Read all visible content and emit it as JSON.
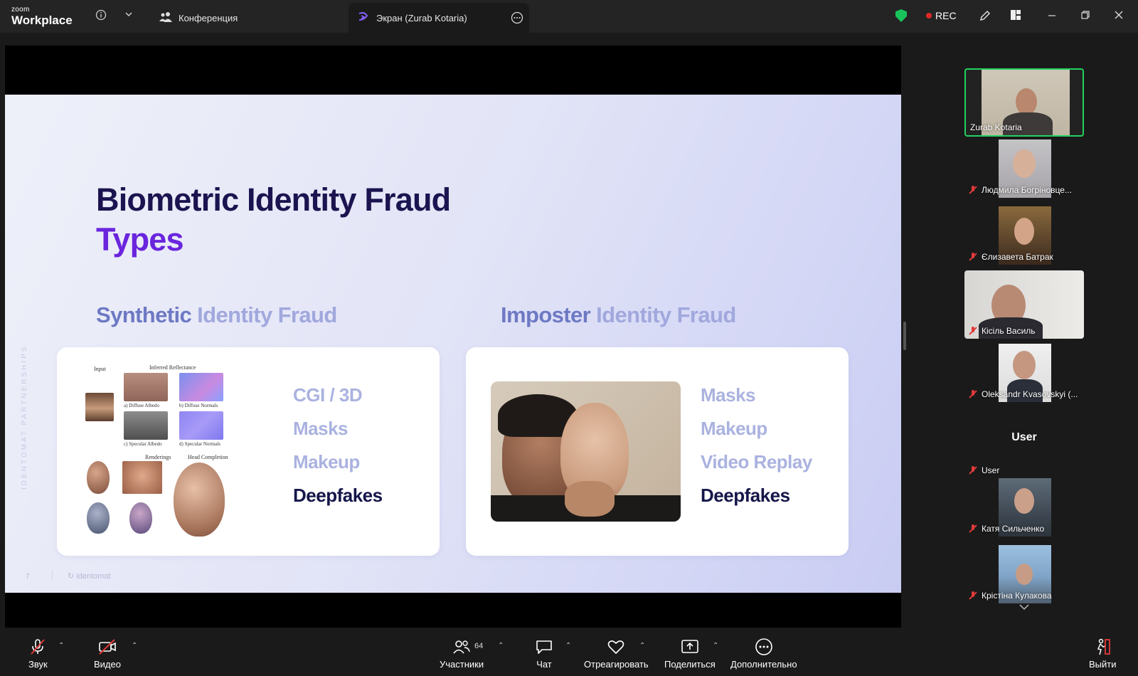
{
  "window": {
    "brand_small": "zoom",
    "brand_big": "Workplace",
    "tab_meeting": "Конференция",
    "tab_screen": "Экран (Zurab Kotaria)",
    "rec_label": "REC"
  },
  "slide": {
    "title_line1": "Biometric Identity Fraud",
    "title_line2": "Types",
    "left_head_a": "Synthetic",
    "left_head_b": " Identity Fraud",
    "right_head_a": "Imposter",
    "right_head_b": " Identity Fraud",
    "left_items": [
      "CGI / 3D",
      "Masks",
      "Makeup",
      "Deepfakes"
    ],
    "right_items": [
      "Masks",
      "Makeup",
      "Video Replay",
      "Deepfakes"
    ],
    "side_text": "IDENTOMAT PARTNERSHIPS",
    "page_number": "7",
    "logo_text": "identomat",
    "figure_labels": {
      "input": "Input",
      "inferred": "Inferred Reflectance",
      "a": "a) Diffuse Albedo",
      "b": "b) Diffuse Normals",
      "c": "c) Specular Albedo",
      "d": "d) Specular Normals",
      "renderings": "Renderings",
      "head_completion": "Head Completion"
    }
  },
  "participants": [
    {
      "name": "Zurab Kotaria",
      "muted": false,
      "speaking": true
    },
    {
      "name": "Людмила Богріновце...",
      "muted": true
    },
    {
      "name": "Єлизавета Батрак",
      "muted": true
    },
    {
      "name": "Кісіль Василь",
      "muted": true
    },
    {
      "name": "Oleksandr Kvasovskyi (...",
      "muted": true
    },
    {
      "name": "User",
      "muted": true,
      "no_video": true
    },
    {
      "name": "Катя Сильченко",
      "muted": true
    },
    {
      "name": "Крістіна Кулакова",
      "muted": true
    }
  ],
  "no_video_title": "User",
  "toolbar": {
    "audio": "Звук",
    "video": "Видео",
    "participants": "Участники",
    "participants_count": "64",
    "chat": "Чат",
    "react": "Отреагировать",
    "share": "Поделиться",
    "more": "Дополнительно",
    "leave": "Выйти"
  }
}
